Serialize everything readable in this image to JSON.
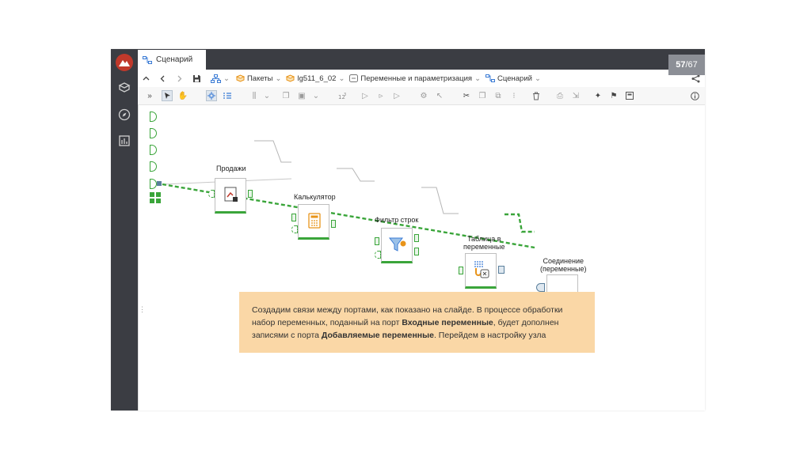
{
  "tab": {
    "label": "Сценарий"
  },
  "slide": {
    "current": "57",
    "separator": "/",
    "total": "67"
  },
  "breadcrumb": {
    "items": [
      {
        "label": "Пакеты"
      },
      {
        "label": "lg511_6_02"
      },
      {
        "label": "Переменные и параметризация"
      },
      {
        "label": "Сценарий"
      }
    ]
  },
  "nodes": {
    "sales": "Продажи",
    "calculator": "Калькулятор",
    "row_filter": "Фильтр строк",
    "table_to_vars_line1": "Таблица в",
    "table_to_vars_line2": "переменные",
    "join_line1": "Соединение",
    "join_line2": "(переменные)"
  },
  "callout": {
    "part1": "Создадим связи между портами, как показано на слайде. В процессе обработки набор переменных, поданный на порт ",
    "bold1": "Входные переменные",
    "part2": ", будет дополнен записями с порта ",
    "bold2": "Добавляемые переменные",
    "part3": ". Перейдем в настройку узла"
  },
  "colors": {
    "accent_green": "#3aa53a",
    "sidebar": "#3b3d43",
    "callout_bg": "#fad7a6",
    "orange": "#e8941a"
  }
}
